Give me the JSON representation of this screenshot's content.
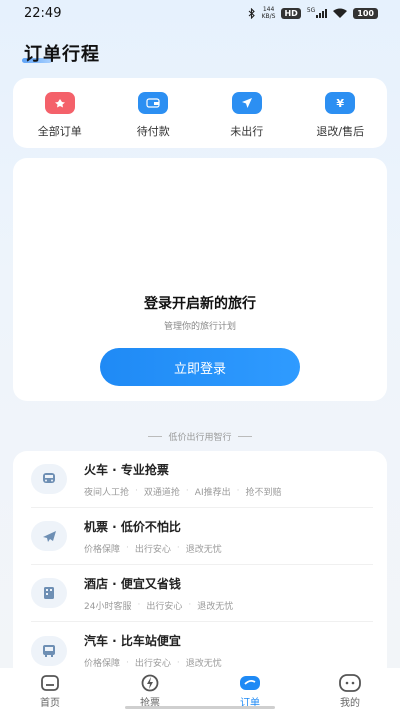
{
  "status_bar": {
    "time": "22:49",
    "speed_value": "144",
    "speed_unit": "KB/S",
    "hd": "HD",
    "network": "5G",
    "battery": "100"
  },
  "page_title": "订单行程",
  "order_tabs": [
    {
      "label": "全部订单",
      "icon": "all-orders-icon",
      "color": "#f4616a"
    },
    {
      "label": "待付款",
      "icon": "card-icon",
      "color": "#2c8ff2"
    },
    {
      "label": "未出行",
      "icon": "plane-send-icon",
      "color": "#2c8ff2"
    },
    {
      "label": "退改/售后",
      "icon": "yen-icon",
      "color": "#2c8ff2"
    }
  ],
  "login": {
    "title": "登录开启新的旅行",
    "subtitle": "管理你的旅行计划",
    "button": "立即登录"
  },
  "divider_text": "低价出行用智行",
  "services": [
    {
      "title": "火车 · 专业抢票",
      "tags": [
        "夜间人工抢",
        "双通道抢",
        "AI推荐出",
        "抢不到赔"
      ],
      "icon": "train-icon"
    },
    {
      "title": "机票 · 低价不怕比",
      "tags": [
        "价格保障",
        "出行安心",
        "退改无忧"
      ],
      "icon": "airplane-icon"
    },
    {
      "title": "酒店 · 便宜又省钱",
      "tags": [
        "24小时客服",
        "出行安心",
        "退改无忧"
      ],
      "icon": "hotel-icon"
    },
    {
      "title": "汽车 · 比车站便宜",
      "tags": [
        "价格保障",
        "出行安心",
        "退改无忧"
      ],
      "icon": "bus-icon"
    }
  ],
  "bottom_nav": [
    {
      "label": "首页",
      "icon": "home-icon",
      "active": false
    },
    {
      "label": "抢票",
      "icon": "lightning-icon",
      "active": false
    },
    {
      "label": "订单",
      "icon": "order-icon",
      "active": true
    },
    {
      "label": "我的",
      "icon": "profile-icon",
      "active": false
    }
  ],
  "colors": {
    "accent": "#1f8af5",
    "red": "#f4616a"
  }
}
